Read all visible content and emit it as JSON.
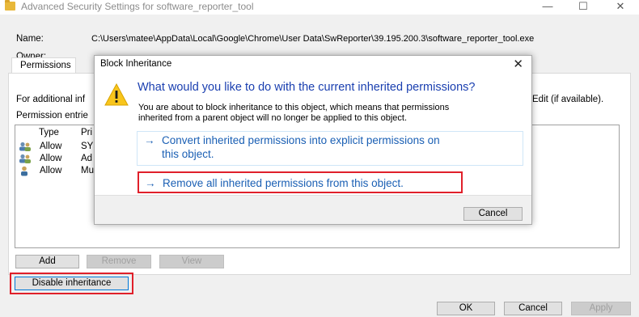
{
  "window": {
    "title": "Advanced Security Settings for software_reporter_tool",
    "minimize": "—",
    "maximize": "☐",
    "close": "✕"
  },
  "info": {
    "name_label": "Name:",
    "name_value": "C:\\Users\\matee\\AppData\\Local\\Google\\Chrome\\User Data\\SwReporter\\39.195.200.3\\software_reporter_tool.exe",
    "owner_label": "Owner:"
  },
  "tabs": {
    "permissions": "Permissions"
  },
  "panel": {
    "additional_info_partial": "For additional inf",
    "edit_partial": "Edit (if available).",
    "entries_partial": "Permission entrie"
  },
  "list": {
    "col_type": "Type",
    "col_principal_partial": "Pri",
    "rows": [
      {
        "type": "Allow",
        "principal_partial": "SYS"
      },
      {
        "type": "Allow",
        "principal_partial": "Ad"
      },
      {
        "type": "Allow",
        "principal_partial": "Mu"
      }
    ]
  },
  "buttons": {
    "add": "Add",
    "remove": "Remove",
    "view": "View",
    "disable_inheritance": "Disable inheritance",
    "ok": "OK",
    "cancel": "Cancel",
    "apply": "Apply"
  },
  "dialog": {
    "title": "Block Inheritance",
    "close": "✕",
    "question": "What would you like to do with the current inherited permissions?",
    "description_line1": "You are about to block inheritance to this object, which means that permissions",
    "description_line2": "inherited from a parent object will no longer be applied to this object.",
    "option_convert_line1": "Convert inherited permissions into explicit permissions on",
    "option_convert_line2": "this object.",
    "option_remove": "Remove all inherited permissions from this object.",
    "arrow": "→",
    "cancel": "Cancel"
  },
  "colors": {
    "highlight": "#e0202a",
    "link_blue": "#1a5fb4",
    "question_blue": "#1a3fb0"
  }
}
